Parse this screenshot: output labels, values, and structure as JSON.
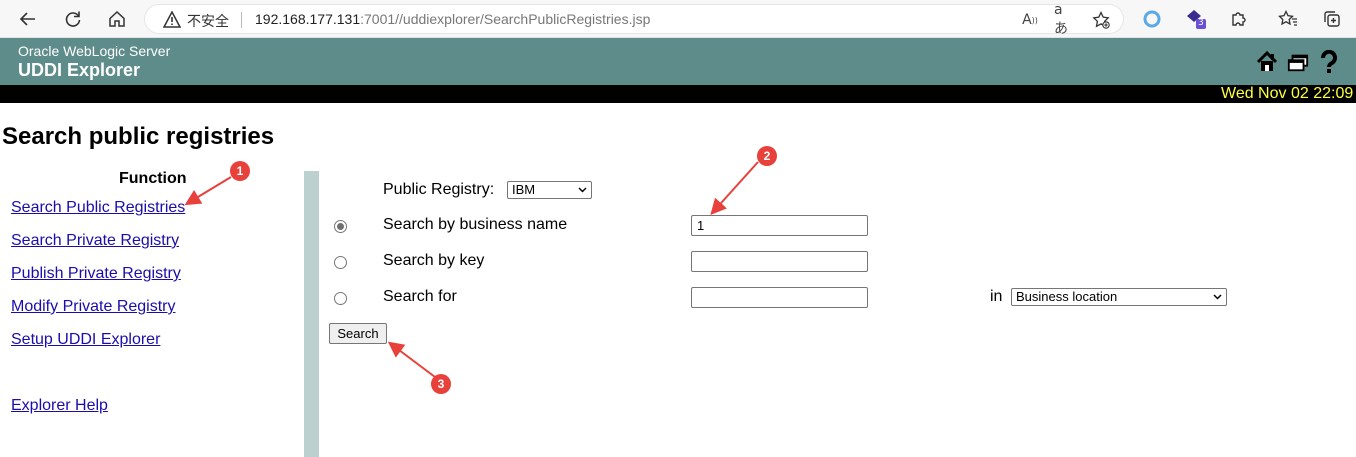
{
  "browser": {
    "security_label": "不安全",
    "url_host": "192.168.177.131",
    "url_rest": ":7001//uddiexplorer/SearchPublicRegistries.jsp",
    "extension_badge": "3",
    "icons": [
      "back-arrow-icon",
      "refresh-icon",
      "home-icon",
      "warning-icon",
      "read-aloud-icon",
      "translate-icon",
      "add-favorite-icon",
      "circle-extension-icon",
      "extension-icon",
      "puzzle-icon",
      "favorites-icon",
      "collections-icon"
    ]
  },
  "banner": {
    "subtitle": "Oracle WebLogic Server",
    "title": "UDDI Explorer",
    "icons": [
      "home-icon",
      "windows-icon",
      "help-icon"
    ]
  },
  "datebar": {
    "text": "Wed Nov 02 22:09"
  },
  "page": {
    "heading": "Search public registries"
  },
  "sidebar": {
    "heading": "Function",
    "links": [
      "Search Public Registries",
      "Search Private Registry",
      "Publish Private Registry",
      "Modify Private Registry",
      "Setup UDDI Explorer"
    ],
    "help_link": "Explorer Help"
  },
  "form": {
    "registry_label": "Public Registry:",
    "registry_value": "IBM",
    "options": [
      {
        "label": "Search by business name",
        "selected": true,
        "value": "1"
      },
      {
        "label": "Search by key",
        "selected": false,
        "value": ""
      },
      {
        "label": "Search for",
        "selected": false,
        "value": ""
      }
    ],
    "in_label": "in",
    "location_value": "Business location",
    "search_button": "Search"
  },
  "annotations": {
    "markers": [
      "1",
      "2",
      "3"
    ],
    "color": "#e8403a"
  },
  "colors": {
    "banner": "#5e8c8a",
    "divider": "#bcd0cf",
    "date_text": "#ffff3c",
    "link": "#1a0dab"
  }
}
